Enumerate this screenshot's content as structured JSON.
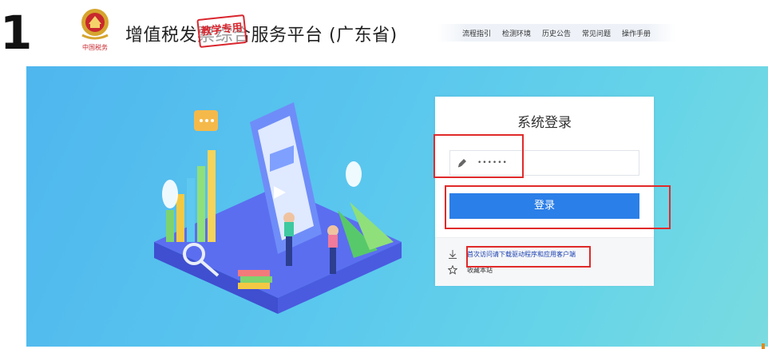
{
  "step_number": "1",
  "header": {
    "title": "增值税发票综合服务平台 (广东省)",
    "stamp_text": "教学专用",
    "emblem_caption": "中国税务"
  },
  "top_nav": {
    "items": [
      "流程指引",
      "检测环境",
      "历史公告",
      "常见问题",
      "操作手册"
    ]
  },
  "login": {
    "title": "系统登录",
    "password_value": "••••••",
    "login_button": "登录",
    "download_link": "首次访问请下载驱动程序和应用客户端",
    "bookmark_label": "收藏本站"
  },
  "colors": {
    "accent": "#2b7fe8",
    "annotation": "#e02a2a",
    "banner_start": "#4fb6ee",
    "banner_end": "#7adbe0"
  }
}
